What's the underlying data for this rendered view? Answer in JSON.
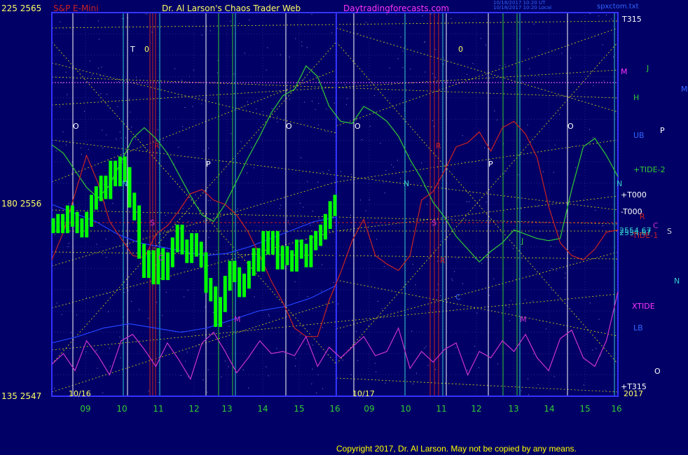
{
  "header": {
    "price_label_top": "225  2565",
    "instrument": "S&P E-Mini",
    "title": "Dr. Al Larson's Chaos Trader Web",
    "website": "Daytradingforecasts.com",
    "timestamp_1": "10/18/2017 10:20 UT",
    "timestamp_2": "10/18/2017 10:20 Local",
    "filename": "spxctom.txt"
  },
  "footer": {
    "copyright": "Copyright 2017, Dr. Al Larson. May not be copied by any means."
  },
  "colors": {
    "background": "#000066",
    "frame": "#3333ff",
    "white_line": "#ffffff",
    "green": "#33cc33",
    "red": "#cc2222",
    "cyan": "#33cccc",
    "yellow": "#ffff00",
    "magenta": "#cc33cc",
    "blue": "#2244ff",
    "price_bars": "#00ff00"
  },
  "chart_data": {
    "type": "line",
    "title": "S&P E-Mini",
    "ylim": [
      2547,
      2565
    ],
    "y_ticks": [
      {
        "value": 2565,
        "label": "225  2565"
      },
      {
        "value": 2556,
        "label": "180  2556"
      },
      {
        "value": 2547,
        "label": "135  2547"
      }
    ],
    "x_ticks_panel_1": [
      "09",
      "10",
      "11",
      "12",
      "13",
      "14",
      "15",
      "16"
    ],
    "x_ticks_panel_2": [
      "09",
      "10",
      "11",
      "12",
      "13",
      "14",
      "15",
      "16"
    ],
    "date_labels": [
      "10/16",
      "10/17",
      "2017"
    ],
    "last_price": "2554.67",
    "right_labels": [
      "T315",
      "M",
      "J",
      "H",
      "UB",
      "+TIDE-2",
      "+T000",
      "-T000",
      "R",
      "C",
      "2554.67",
      "-TIDE-1",
      "XTIDE",
      "LB",
      "+T315",
      "S",
      "P",
      "N",
      "O",
      "M"
    ],
    "chart_markers": [
      "T",
      "0",
      "O",
      "N",
      "S",
      "R",
      "P",
      "M",
      "C",
      "J"
    ],
    "series": [
      {
        "name": "price",
        "values": [
          2555.0,
          2555.2,
          2555.0,
          2555.6,
          2555.3,
          2555.0,
          2554.8,
          2555.3,
          2556.1,
          2556.5,
          2557.0,
          2556.6,
          2557.7,
          2557.2,
          2557.9,
          2557.4,
          2556.2,
          2555.6,
          2553.8,
          2552.9,
          2553.5,
          2552.6,
          2553.6,
          2552.8,
          2553.4,
          2554.1,
          2554.7,
          2554.0,
          2553.6,
          2554.3,
          2553.9,
          2553.4,
          2552.2,
          2551.8,
          2550.6,
          2551.3,
          2552.3,
          2553.0,
          2552.7,
          2552.0,
          2552.4,
          2553.0,
          2553.6,
          2553.2,
          2554.4,
          2554.0,
          2554.4,
          2553.3,
          2553.7,
          2553.5,
          2553.2,
          2554.0,
          2553.8,
          2553.4,
          2554.2,
          2554.4,
          2554.7,
          2555.2,
          2555.8,
          2556.1
        ]
      },
      {
        "name": "+TIDE-2",
        "values": [
          2558.8,
          2558.4,
          2557.6,
          2556.8,
          2556.3,
          2556.9,
          2558.0,
          2559.1,
          2559.6,
          2559.1,
          2558.4,
          2557.4,
          2556.4,
          2555.5,
          2555.2,
          2556.0,
          2557.1,
          2558.2,
          2559.2,
          2560.3,
          2561.1,
          2561.4,
          2562.5,
          2562.0,
          2560.6,
          2559.9,
          2559.8,
          2560.6,
          2560.3,
          2559.9,
          2559.2,
          2558.1,
          2557.2,
          2556.1,
          2555.4,
          2554.5,
          2553.9,
          2553.3,
          2553.8,
          2554.2,
          2554.8,
          2554.6,
          2554.4,
          2554.3,
          2554.4,
          2556.7,
          2558.7,
          2559.1,
          2558.3,
          2557.3
        ]
      },
      {
        "name": "-TIDE-1",
        "values": [
          2553.4,
          2554.7,
          2556.5,
          2558.3,
          2557.0,
          2555.2,
          2554.4,
          2553.6,
          2553.5,
          2554.6,
          2555.0,
          2555.7,
          2556.5,
          2556.7,
          2556.2,
          2556.0,
          2555.5,
          2554.7,
          2553.6,
          2552.4,
          2551.4,
          2550.2,
          2549.8,
          2549.8,
          2551.5,
          2552.8,
          2554.3,
          2555.3,
          2553.6,
          2553.2,
          2552.9,
          2553.6,
          2556.2,
          2556.6,
          2557.6,
          2558.7,
          2558.9,
          2559.4,
          2558.5,
          2559.6,
          2559.9,
          2559.3,
          2558.2,
          2555.9,
          2554.2,
          2553.6,
          2553.4,
          2553.9,
          2554.7,
          2554.8
        ]
      },
      {
        "name": "XTIDE",
        "values": [
          2548.5,
          2549.0,
          2548.2,
          2549.6,
          2548.9,
          2548.0,
          2549.6,
          2549.9,
          2549.2,
          2548.4,
          2549.5,
          2548.7,
          2547.8,
          2549.5,
          2550.0,
          2549.1,
          2548.1,
          2548.8,
          2549.6,
          2549.0,
          2549.1,
          2548.9,
          2549.8,
          2548.4,
          2549.3,
          2548.8,
          2549.3,
          2549.8,
          2548.9,
          2549.1,
          2550.2,
          2548.3,
          2549.1,
          2548.6,
          2549.2,
          2549.5,
          2548.0,
          2549.1,
          2548.8,
          2549.6,
          2549.1,
          2549.9,
          2548.8,
          2548.2,
          2549.7,
          2550.1,
          2548.8,
          2548.4,
          2549.6,
          2551.9
        ]
      }
    ]
  }
}
